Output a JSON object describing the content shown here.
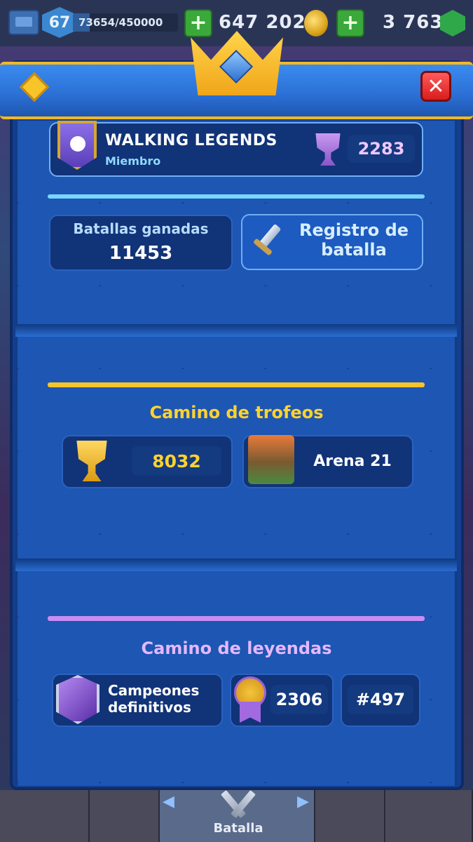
{
  "topbar": {
    "level": "67",
    "xp": "73654/450000",
    "xp_progress": 0.16,
    "gold": "647 202",
    "gems": "3 763",
    "plus": "+"
  },
  "dialog": {
    "close": "✕"
  },
  "clan": {
    "name": "WALKING LEGENDS",
    "role": "Miembro",
    "trophies": "2283"
  },
  "stats": {
    "battles_won_label": "Batallas ganadas",
    "battles_won_value": "11453",
    "battle_log_label": "Registro de batalla"
  },
  "trophy_road": {
    "title": "Camino de trofeos",
    "trophies": "8032",
    "arena": "Arena 21"
  },
  "legends_road": {
    "title": "Camino de leyendas",
    "league": "Campeones definitivos",
    "rating": "2306",
    "rank": "#497"
  },
  "nav": {
    "active_label": "Batalla",
    "left_arrow": "◀",
    "right_arrow": "▶"
  },
  "colors": {
    "gold_accent": "#f7c52a",
    "purple_accent": "#c98cf2",
    "light_accent": "#7ad6ff"
  }
}
